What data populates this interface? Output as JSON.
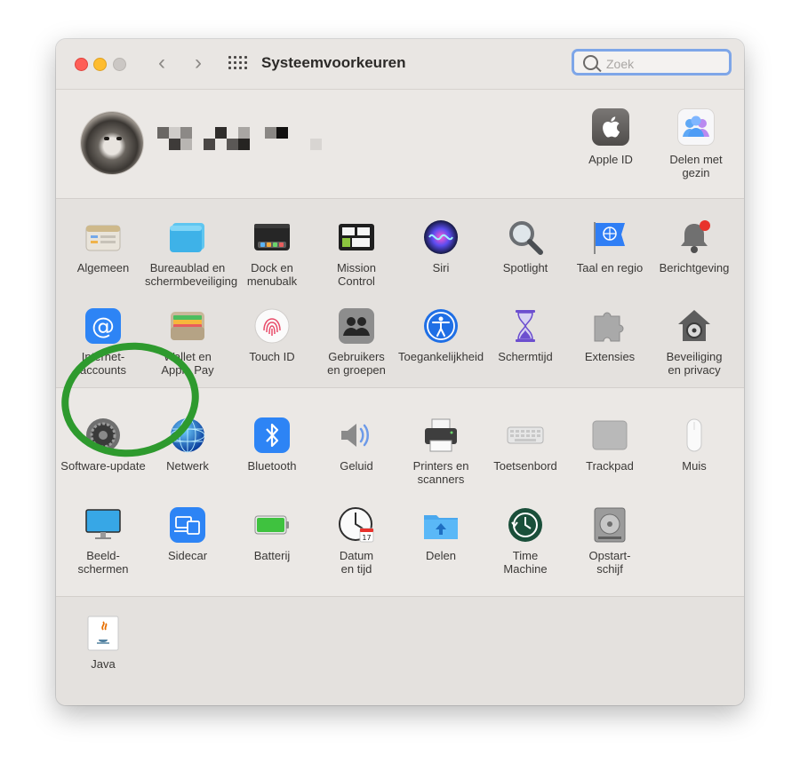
{
  "window": {
    "title": "Systeemvoorkeuren",
    "search_placeholder": "Zoek"
  },
  "account": {
    "top_panes": [
      {
        "label": "Apple ID",
        "icon": "apple-id-icon"
      },
      {
        "label": "Delen met\ngezin",
        "icon": "family-sharing-icon"
      }
    ]
  },
  "sections": [
    {
      "rows": [
        [
          {
            "label": "Algemeen",
            "icon": "general-icon"
          },
          {
            "label": "Bureaublad en\nschermbeveiliging",
            "icon": "desktop-screensaver-icon"
          },
          {
            "label": "Dock en\nmenubalk",
            "icon": "dock-icon"
          },
          {
            "label": "Mission\nControl",
            "icon": "mission-control-icon"
          },
          {
            "label": "Siri",
            "icon": "siri-icon"
          },
          {
            "label": "Spotlight",
            "icon": "spotlight-icon"
          },
          {
            "label": "Taal en regio",
            "icon": "language-region-icon"
          },
          {
            "label": "Berichtgeving",
            "icon": "notifications-icon"
          }
        ],
        [
          {
            "label": "Internet-\naccounts",
            "icon": "internet-accounts-icon"
          },
          {
            "label": "Wallet en\nApple Pay",
            "icon": "wallet-icon"
          },
          {
            "label": "Touch ID",
            "icon": "touch-id-icon"
          },
          {
            "label": "Gebruikers\nen groepen",
            "icon": "users-groups-icon"
          },
          {
            "label": "Toegankelijkheid",
            "icon": "accessibility-icon"
          },
          {
            "label": "Schermtijd",
            "icon": "screen-time-icon"
          },
          {
            "label": "Extensies",
            "icon": "extensions-icon"
          },
          {
            "label": "Beveiliging\nen privacy",
            "icon": "security-privacy-icon"
          }
        ]
      ]
    },
    {
      "rows": [
        [
          {
            "label": "Software-update",
            "icon": "software-update-icon"
          },
          {
            "label": "Netwerk",
            "icon": "network-icon"
          },
          {
            "label": "Bluetooth",
            "icon": "bluetooth-icon"
          },
          {
            "label": "Geluid",
            "icon": "sound-icon"
          },
          {
            "label": "Printers en\nscanners",
            "icon": "printers-icon"
          },
          {
            "label": "Toetsenbord",
            "icon": "keyboard-icon"
          },
          {
            "label": "Trackpad",
            "icon": "trackpad-icon"
          },
          {
            "label": "Muis",
            "icon": "mouse-icon"
          }
        ],
        [
          {
            "label": "Beeld-\nschermen",
            "icon": "displays-icon"
          },
          {
            "label": "Sidecar",
            "icon": "sidecar-icon"
          },
          {
            "label": "Batterij",
            "icon": "battery-icon"
          },
          {
            "label": "Datum\nen tijd",
            "icon": "date-time-icon"
          },
          {
            "label": "Delen",
            "icon": "sharing-icon"
          },
          {
            "label": "Time\nMachine",
            "icon": "time-machine-icon"
          },
          {
            "label": "Opstart-\nschijf",
            "icon": "startup-disk-icon"
          }
        ]
      ]
    },
    {
      "rows": [
        [
          {
            "label": "Java",
            "icon": "java-icon"
          }
        ]
      ]
    }
  ],
  "annotation": {
    "highlighted_pane": "Netwerk",
    "ring_color": "#2e9a2e"
  }
}
